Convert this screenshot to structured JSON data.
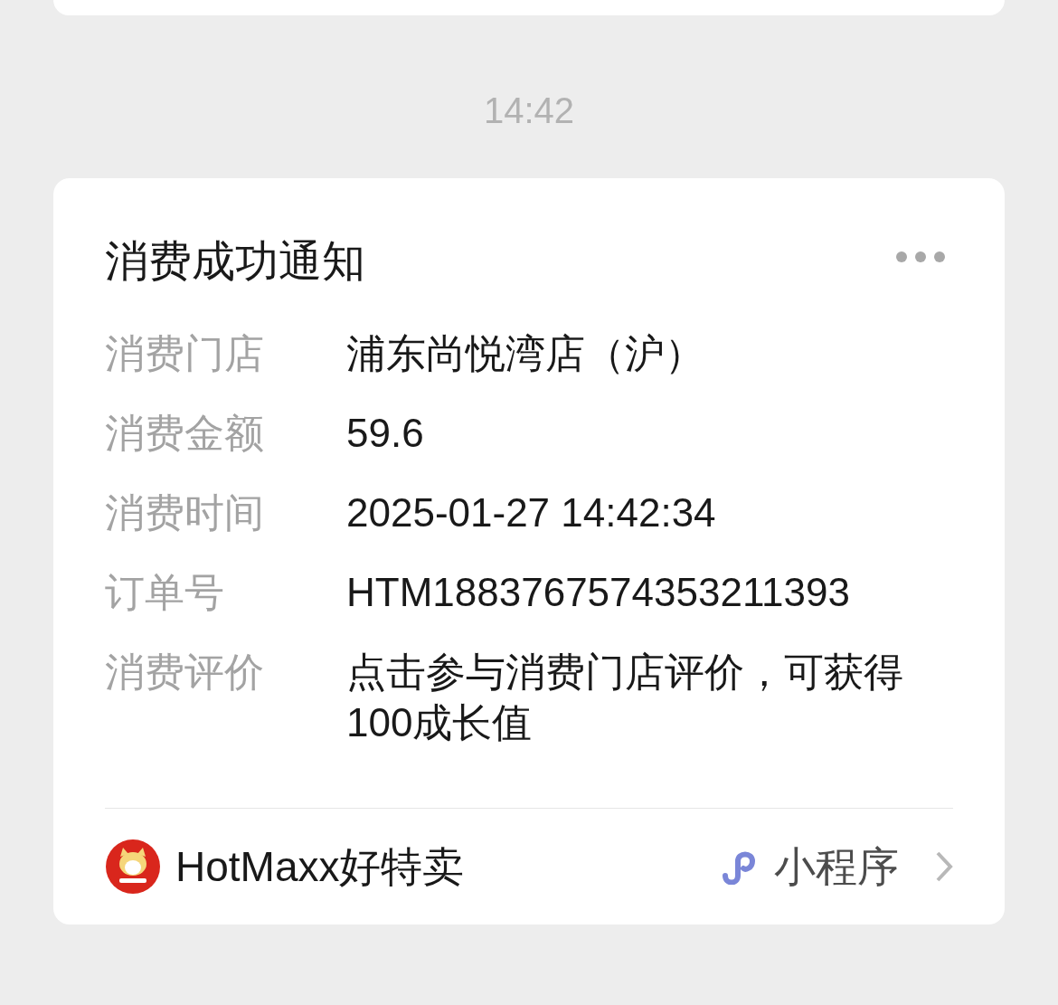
{
  "time": "14:42",
  "card": {
    "title": "消费成功通知",
    "fields": [
      {
        "label": "消费门店",
        "value": "浦东尚悦湾店（沪）"
      },
      {
        "label": "消费金额",
        "value": "59.6"
      },
      {
        "label": "消费时间",
        "value": "2025-01-27 14:42:34"
      },
      {
        "label": "订单号",
        "value": "HTM1883767574353211393"
      },
      {
        "label": "消费评价",
        "value": "点击参与消费门店评价，可获得100成长值"
      }
    ],
    "source": {
      "name": "HotMaxx好特卖",
      "type": "小程序"
    }
  }
}
